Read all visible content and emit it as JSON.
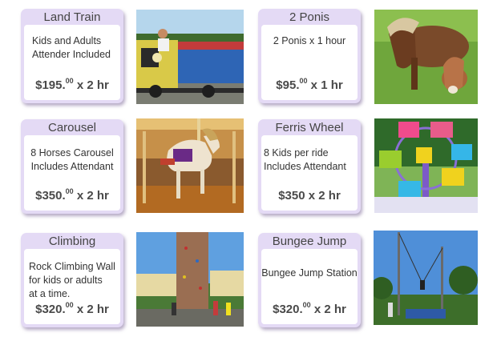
{
  "items": [
    {
      "title": "Land Train",
      "desc_lines": [
        "Kids and Adults",
        "Attender Included"
      ],
      "price_main": "$195.",
      "price_cents": "00",
      "price_rest": " x 2 hr",
      "photo_icon": "land-train-photo"
    },
    {
      "title": "2 Ponis",
      "desc_lines": [
        "2 Ponis x 1 hour"
      ],
      "price_main": "$95.",
      "price_cents": "00",
      "price_rest": " x 1 hr",
      "photo_icon": "ponies-photo"
    },
    {
      "title": "Carousel",
      "desc_lines": [
        "8 Horses Carousel",
        "Includes Attendant"
      ],
      "price_main": "$350.",
      "price_cents": "00",
      "price_rest": " x 2 hr",
      "photo_icon": "carousel-photo"
    },
    {
      "title": "Ferris Wheel",
      "desc_lines": [
        "8 Kids per ride",
        "Includes Attendant"
      ],
      "price_main": "$350 x 2 hr",
      "price_cents": "",
      "price_rest": "",
      "photo_icon": "ferris-wheel-photo"
    },
    {
      "title": "Climbing",
      "desc_lines": [
        "Rock Climbing Wall",
        "for kids or adults",
        "at a time."
      ],
      "price_main": "$320.",
      "price_cents": "00",
      "price_rest": " x 2 hr",
      "photo_icon": "climbing-wall-photo"
    },
    {
      "title": "Bungee Jump",
      "desc_lines": [
        "Bungee Jump Station"
      ],
      "price_main": "$320.",
      "price_cents": "00",
      "price_rest": " x 2 hr",
      "photo_icon": "bungee-jump-photo"
    }
  ]
}
